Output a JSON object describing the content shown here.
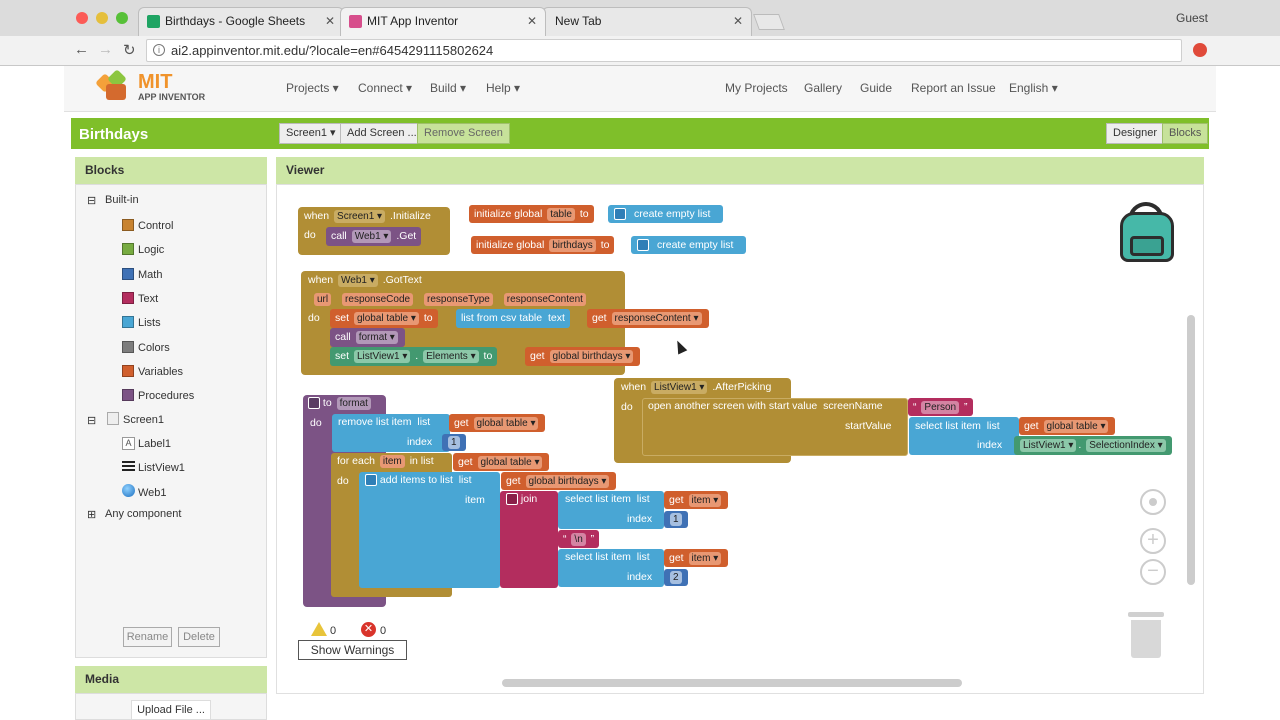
{
  "browser": {
    "tabs": [
      {
        "label": "Birthdays - Google Sheets"
      },
      {
        "label": "MIT App Inventor"
      },
      {
        "label": "New Tab"
      }
    ],
    "profile": "Guest",
    "url": "ai2.appinventor.mit.edu/?locale=en#6454291115802624"
  },
  "header": {
    "logo_line1": "MIT",
    "logo_line2": "APP INVENTOR",
    "menus": [
      "Projects ▾",
      "Connect ▾",
      "Build ▾",
      "Help ▾"
    ],
    "right_links": [
      "My Projects",
      "Gallery",
      "Guide",
      "Report an Issue",
      "English ▾"
    ]
  },
  "toolbar": {
    "project_name": "Birthdays",
    "screen_select": "Screen1 ▾",
    "add_screen": "Add Screen ...",
    "remove_screen": "Remove Screen",
    "designer": "Designer",
    "blocks": "Blocks"
  },
  "blocks_panel": {
    "title": "Blocks",
    "builtin_label": "Built-in",
    "builtin": [
      {
        "label": "Control",
        "color": "#c88330"
      },
      {
        "label": "Logic",
        "color": "#77ab41"
      },
      {
        "label": "Math",
        "color": "#3f71b5"
      },
      {
        "label": "Text",
        "color": "#b32d5e"
      },
      {
        "label": "Lists",
        "color": "#49a6d4"
      },
      {
        "label": "Colors",
        "color": "#7d7d7d"
      },
      {
        "label": "Variables",
        "color": "#d05f2d"
      },
      {
        "label": "Procedures",
        "color": "#7c5385"
      }
    ],
    "screen_label": "Screen1",
    "components": [
      "Label1",
      "ListView1",
      "Web1"
    ],
    "any_component": "Any component",
    "rename": "Rename",
    "delete": "Delete"
  },
  "media": {
    "title": "Media",
    "upload": "Upload File ..."
  },
  "viewer": {
    "title": "Viewer",
    "warnings_count": "0",
    "errors_count": "0",
    "show_warnings": "Show Warnings"
  },
  "blocks": {
    "b1_when": "when",
    "b1_comp": "Screen1 ▾",
    "b1_event": ".Initialize",
    "b1_do": "do",
    "b1_call": "call",
    "b1_web": "Web1 ▾",
    "b1_get": ".Get",
    "b2_init": "initialize global",
    "b2_name": "table",
    "b2_to": "to",
    "b2_list": "create empty list",
    "b3_init": "initialize global",
    "b3_name": "birthdays",
    "b3_to": "to",
    "b3_list": "create empty list",
    "b4_when": "when",
    "b4_comp": "Web1 ▾",
    "b4_event": ".GotText",
    "b4_params": [
      "url",
      "responseCode",
      "responseType",
      "responseContent"
    ],
    "b4_do": "do",
    "b4_set": "set",
    "b4_var": "global table ▾",
    "b4_to": "to",
    "b4_csv": "list from csv table",
    "b4_text": "text",
    "b4_get": "get",
    "b4_get_var": "responseContent ▾",
    "b4_call": "call",
    "b4_format": "format ▾",
    "b4_set2": "set",
    "b4_lv": "ListView1 ▾",
    "b4_dot": ".",
    "b4_elements": "Elements ▾",
    "b4_to2": "to",
    "b4_get2": "get",
    "b4_get2_var": "global birthdays ▾",
    "b5_when": "when",
    "b5_comp": "ListView1 ▾",
    "b5_event": ".AfterPicking",
    "b5_do": "do",
    "b5_open": "open another screen with start value",
    "b5_screen": "screenName",
    "b5_person": "Person",
    "b5_start": "startValue",
    "b5_select": "select list item",
    "b5_list": "list",
    "b5_get": "get",
    "b5_get_var": "global table ▾",
    "b5_index": "index",
    "b5_lv": "ListView1 ▾",
    "b5_sel": "SelectionIndex ▾",
    "b6_to": "to",
    "b6_name": "format",
    "b6_do": "do",
    "b6_remove": "remove list item",
    "b6_list": "list",
    "b6_get": "get",
    "b6_get_var": "global table ▾",
    "b6_index": "index",
    "b6_index_val": "1",
    "b6_for": "for each",
    "b6_item": "item",
    "b6_inlist": "in list",
    "b6_get2": "get",
    "b6_get2_var": "global table ▾",
    "b6_do2": "do",
    "b6_add": "add items to list",
    "b6_list2": "list",
    "b6_get3": "get",
    "b6_get3_var": "global birthdays ▾",
    "b6_itemlbl": "item",
    "b6_join": "join",
    "b6_sel1": "select list item",
    "b6_sel1_list": "list",
    "b6_sel1_get": "get",
    "b6_sel1_var": "item ▾",
    "b6_sel1_index": "index",
    "b6_sel1_val": "1",
    "b6_nl": "\\n",
    "b6_sel2": "select list item",
    "b6_sel2_list": "list",
    "b6_sel2_get": "get",
    "b6_sel2_var": "item ▾",
    "b6_sel2_index": "index",
    "b6_sel2_val": "2"
  },
  "colors": {
    "green_bar": "#7fbf2a",
    "panel_header": "#cde6a6",
    "control": "#b18e35",
    "procedure": "#7c5385",
    "variable": "#d05f2d",
    "list": "#49a6d4",
    "text": "#b32d5e",
    "math": "#3f71b5",
    "component": "#439970"
  }
}
